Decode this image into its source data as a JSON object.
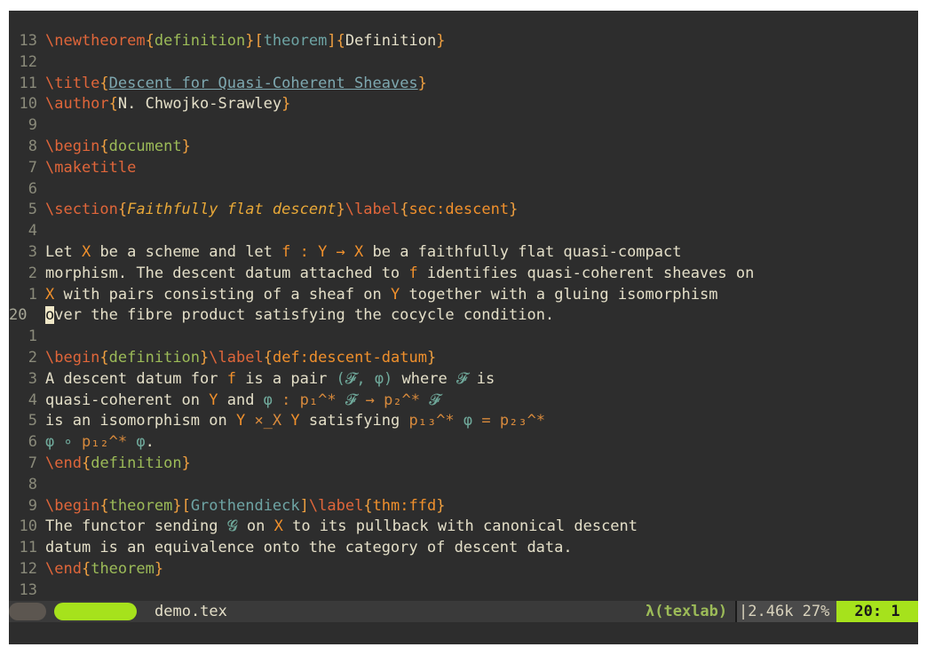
{
  "editor": {
    "lines": [
      {
        "num": "13",
        "html": "<span class=\"cmd\">\\newtheorem</span><span class=\"br\">{</span><span class=\"env\">definition</span><span class=\"br\">}[</span><span class=\"opt\">theorem</span><span class=\"br\">]{</span>Definition<span class=\"br\">}</span>"
      },
      {
        "num": "12",
        "html": ""
      },
      {
        "num": "11",
        "html": "<span class=\"cmd\">\\title</span><span class=\"br\">{</span><span class=\"link\">Descent for Quasi-Coherent Sheaves</span><span class=\"br\">}</span>"
      },
      {
        "num": "10",
        "html": "<span class=\"cmd\">\\author</span><span class=\"br\">{</span>N. Chwojko-Srawley<span class=\"br\">}</span>"
      },
      {
        "num": "9",
        "html": ""
      },
      {
        "num": "8",
        "html": "<span class=\"cmd\">\\begin</span><span class=\"br\">{</span><span class=\"env\">document</span><span class=\"br\">}</span>"
      },
      {
        "num": "7",
        "html": "<span class=\"cmd\">\\maketitle</span>"
      },
      {
        "num": "6",
        "html": ""
      },
      {
        "num": "5",
        "html": "<span class=\"cmd\">\\section</span><span class=\"br\">{</span><span class=\"it\">Faithfully flat descent</span><span class=\"br\">}</span><span class=\"cmd\">\\label</span><span class=\"br\">{</span><span class=\"var\">sec:descent</span><span class=\"br\">}</span>"
      },
      {
        "num": "4",
        "html": ""
      },
      {
        "num": "3",
        "html": "Let <span class=\"var\">X</span> be a scheme and let <span class=\"var\">f : Y → X</span> be a faithfully flat quasi-compact"
      },
      {
        "num": "2",
        "html": "morphism. The descent datum attached to <span class=\"var\">f</span> identifies quasi-coherent sheaves on"
      },
      {
        "num": "1",
        "html": "<span class=\"var\">X</span> with pairs consisting of a sheaf on <span class=\"var\">Y</span> together with a gluing isomorphism"
      },
      {
        "num": "20",
        "current": true,
        "html": "<span class=\"cursor\">o</span>ver the fibre product satisfying the cocycle condition."
      },
      {
        "num": "1",
        "html": ""
      },
      {
        "num": "2",
        "html": "<span class=\"cmd\">\\begin</span><span class=\"br\">{</span><span class=\"env\">definition</span><span class=\"br\">}</span><span class=\"cmd\">\\label</span><span class=\"br\">{</span><span class=\"var\">def:descent-datum</span><span class=\"br\">}</span>"
      },
      {
        "num": "3",
        "html": "A descent datum for <span class=\"var\">f</span> is a pair <span class=\"teal\">(</span><span class=\"teal\">𝓕, φ)</span> where <span class=\"teal\">𝓕</span> is"
      },
      {
        "num": "4",
        "html": "quasi-coherent on <span class=\"var\">Y</span> and <span class=\"teal\">φ</span> <span class=\"math\">: p₁^* </span><span class=\"teal\">𝓕</span><span class=\"math\"> → p₂^* </span><span class=\"teal\">𝓕</span>"
      },
      {
        "num": "5",
        "html": "is an isomorphism on <span class=\"var\">Y</span> <span class=\"math\">×_X</span> <span class=\"var\">Y</span> satisfying <span class=\"math\">p₁₃^* </span><span class=\"teal\">φ</span><span class=\"math\"> = p₂₃^*</span>"
      },
      {
        "num": "6",
        "html": "<span class=\"teal\">φ ∘ </span><span class=\"math\">p₁₂^* </span><span class=\"teal\">φ</span>."
      },
      {
        "num": "7",
        "html": "<span class=\"cmd\">\\end</span><span class=\"br\">{</span><span class=\"env\">definition</span><span class=\"br\">}</span>"
      },
      {
        "num": "8",
        "html": ""
      },
      {
        "num": "9",
        "html": "<span class=\"cmd\">\\begin</span><span class=\"br\">{</span><span class=\"env\">theorem</span><span class=\"br\">}[</span><span class=\"opt\">Grothendieck</span><span class=\"br\">]</span><span class=\"cmd\">\\label</span><span class=\"br\">{</span><span class=\"var\">thm:ffd</span><span class=\"br\">}</span>"
      },
      {
        "num": "10",
        "html": "The functor sending <span class=\"teal\">𝓖</span> on <span class=\"var\">X</span> to its pullback with canonical descent"
      },
      {
        "num": "11",
        "html": "datum is an equivalence onto the category of descent data."
      },
      {
        "num": "12",
        "html": "<span class=\"cmd\">\\end</span><span class=\"br\">{</span><span class=\"env\">theorem</span><span class=\"br\">}</span>"
      },
      {
        "num": "13",
        "html": ""
      }
    ]
  },
  "statusbar": {
    "file_name": "demo.tex",
    "lsp_status": "λ(texlab)",
    "file_info": "2.46k 27%",
    "cursor_position": "20: 1"
  }
}
